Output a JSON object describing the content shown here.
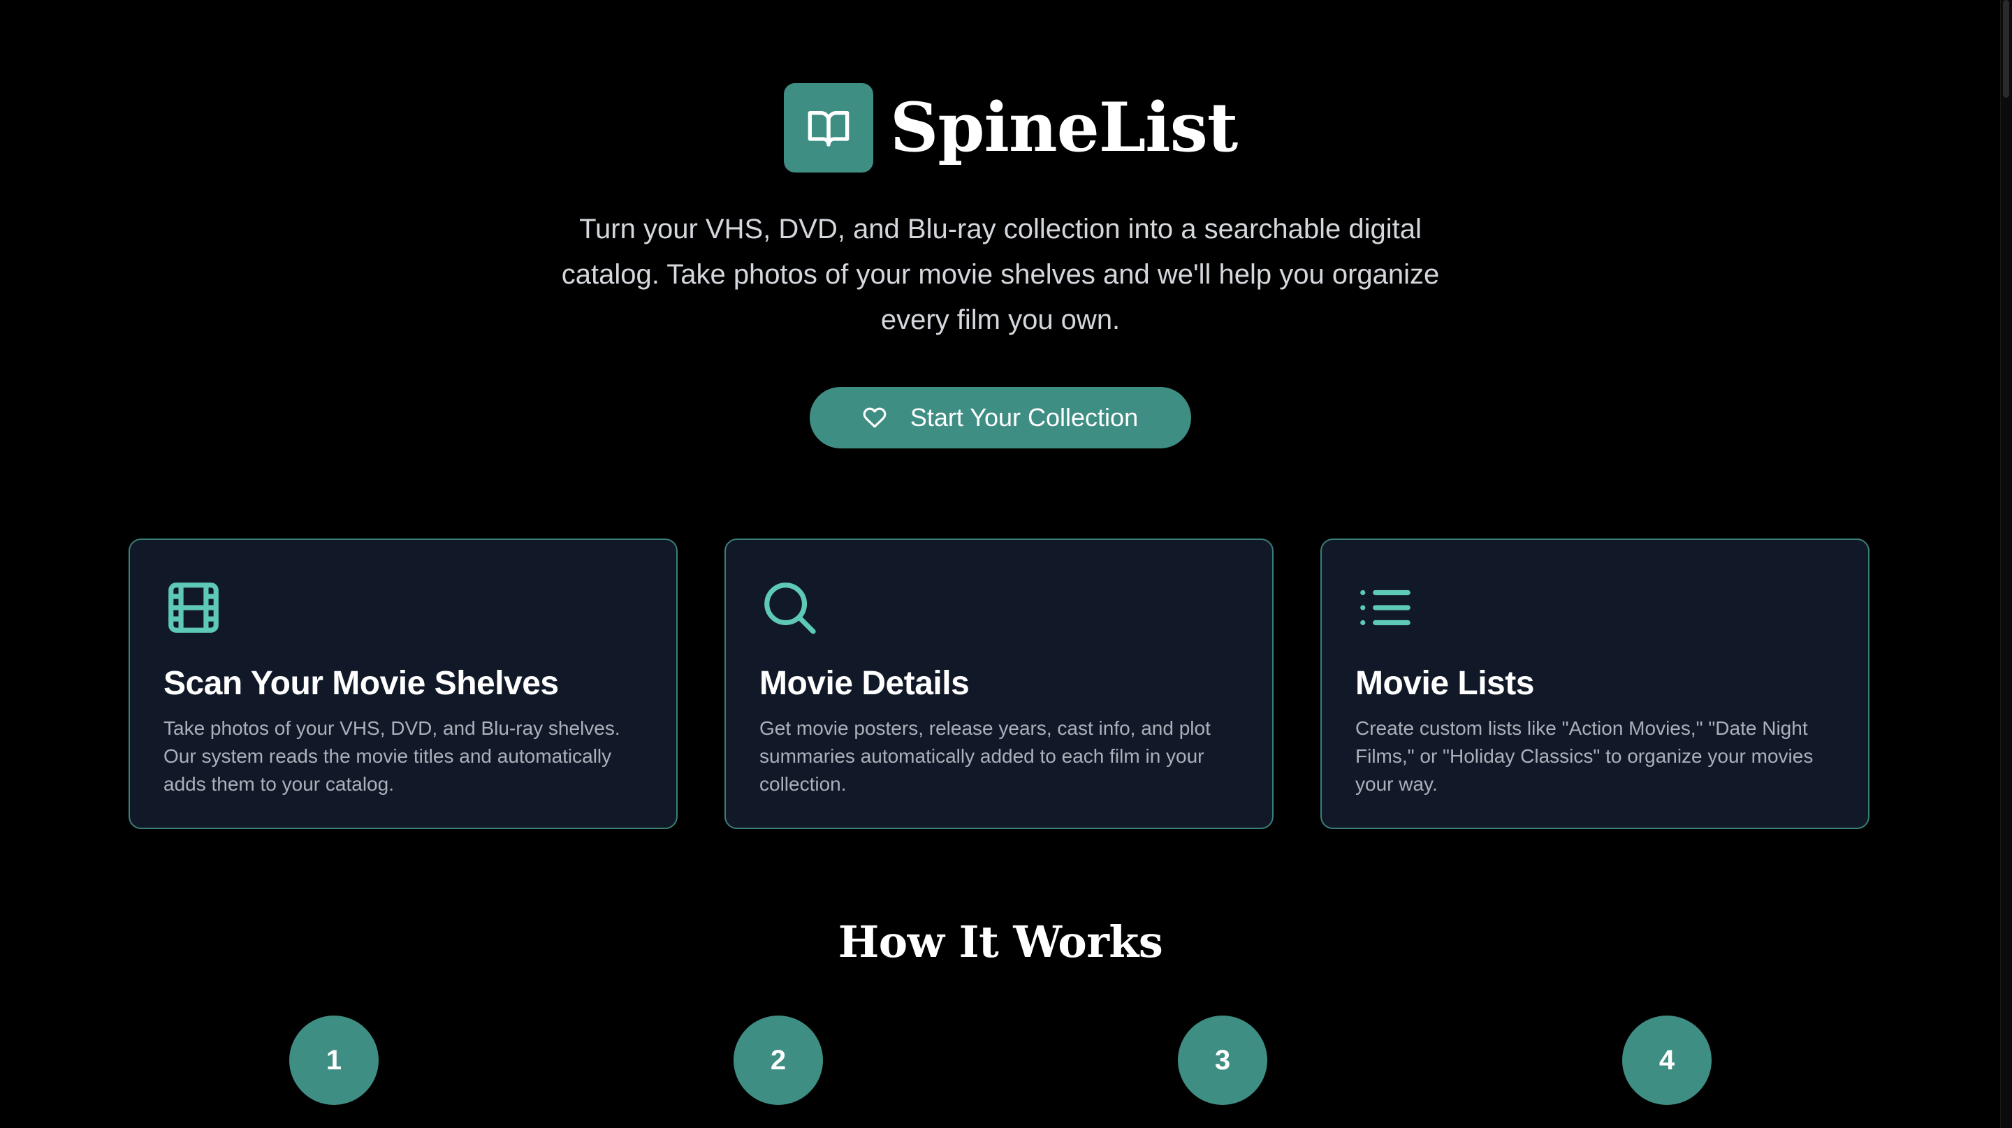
{
  "brand": {
    "name": "SpineList",
    "logo_icon": "open-book-icon",
    "accent_color": "#3f8e84"
  },
  "hero": {
    "tagline": "Turn your VHS, DVD, and Blu-ray collection into a searchable digital catalog. Take photos of your movie shelves and we'll help you organize every film you own.",
    "cta_label": "Start Your Collection",
    "cta_icon": "heart-icon"
  },
  "features": [
    {
      "icon": "film-icon",
      "title": "Scan Your Movie Shelves",
      "description": "Take photos of your VHS, DVD, and Blu-ray shelves. Our system reads the movie titles and automatically adds them to your catalog."
    },
    {
      "icon": "search-icon",
      "title": "Movie Details",
      "description": "Get movie posters, release years, cast info, and plot summaries automatically added to each film in your collection."
    },
    {
      "icon": "list-icon",
      "title": "Movie Lists",
      "description": "Create custom lists like \"Action Movies,\" \"Date Night Films,\" or \"Holiday Classics\" to organize your movies your way."
    }
  ],
  "how_it_works": {
    "heading": "How It Works",
    "steps": [
      "1",
      "2",
      "3",
      "4"
    ]
  }
}
